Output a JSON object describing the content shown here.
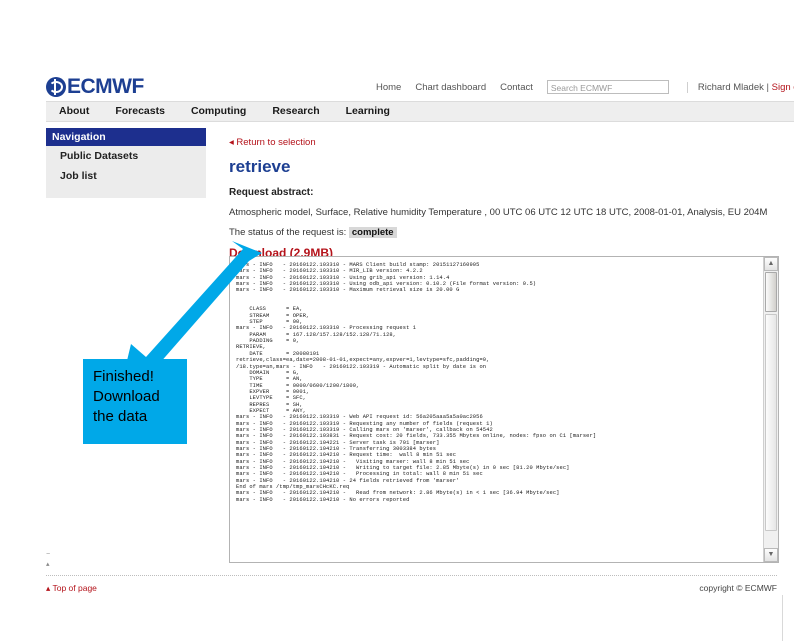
{
  "brand": {
    "wordmark": "ECMWF",
    "logo_icon": "ecmwf-globe-icon"
  },
  "utility_nav": {
    "items": [
      "Home",
      "Chart dashboard",
      "Contact"
    ],
    "search_placeholder": "Search ECMWF",
    "user_name": "Richard Mladek",
    "separator": "|",
    "sign_out": "Sign out"
  },
  "menubar": {
    "items": [
      "About",
      "Forecasts",
      "Computing",
      "Research",
      "Learning"
    ]
  },
  "sidebar": {
    "header": "Navigation",
    "items": [
      "Public Datasets",
      "Job list"
    ]
  },
  "content": {
    "back_link": "◂ Return to selection",
    "title": "retrieve",
    "abstract_label": "Request abstract:",
    "abstract": "Atmospheric model, Surface, Relative humidity Temperature , 00 UTC 06 UTC 12 UTC 18 UTC, 2008-01-01, Analysis, EU 204M",
    "status_prefix": "The status of the request is:",
    "status_value": "complete",
    "download_label": "Download (2.9MB)"
  },
  "console": {
    "log": "mars - INFO   - 20160122.103310 - MARS Client build stamp: 20151127160905\nmars - INFO   - 20160122.103310 - MIR_LIB version: 4.2.2\nmars - INFO   - 20160122.103310 - Using grib_api version: 1.14.4\nmars - INFO   - 20160122.103310 - Using odb_api version: 0.10.2 (File format version: 0.5)\nmars - INFO   - 20160122.103310 - Maximum retrieval size is 20.00 G\n\n\n    CLASS      = EA,\n    STREAM     = OPER,\n    STEP       = 00,\nmars - INFO   - 20160122.103310 - Processing request 1\n    PARAM      = 167.128/157.128/152.128/71.128,\n    PADDING    = 0,\nRETRIEVE,\n    DATE       = 20080101\nretrieve,class=ea,date=2008-01-01,expect=any,expver=1,levtype=sfc,padding=0,\n/18.type=an,mars - INFO   - 20160122.103319 - Automatic split by date is on\n    DOMAIN     = G,\n    TYPE       = AN,\n    TIME       = 0000/0600/1200/1800,\n    EXPVER     = 0001,\n    LEVTYPE    = SFC,\n    REPRES     = SH,\n    EXPECT     = ANY,\nmars - INFO   - 20160122.103319 - Web API request id: 56a205aaa5a5a0ac2056\nmars - INFO   - 20160122.103319 - Requesting any number of fields (request 1)\nmars - INFO   - 20160122.103319 - Calling mars on 'marser', callback on 54542\nmars - INFO   - 20160122.103831 - Request cost: 20 fields, 733.355 Mbytes online, nodes: fpso on C1 [marser]\nmars - INFO   - 20160122.104221 - Server task is 701 [marser]\nmars - INFO   - 20160122.104210 - Transferring 3003384 bytes\nmars - INFO   - 20160122.104210 - Request time:  wall 8 min 51 sec\nmars - INFO   - 20160122.104210 -   Visiting marser: wall 8 min 51 sec\nmars - INFO   - 20160122.104210 -   Writing to target file: 2.85 Mbyte(s) in 0 sec [81.20 Mbyte/sec]\nmars - INFO   - 20160122.104210 -   Processing in total: wall 8 min 51 sec\nmars - INFO   - 20160122.104210 - 24 fields retrieved from 'marser'\nEnd of mars /tmp/tmp_marsCHcKC.req\nmars - INFO   - 20160122.104210 -   Read from network: 2.86 Mbyte(s) in < 1 sec [36.94 Mbyte/sec]\nmars - INFO   - 20160122.104210 - No errors reported",
    "scroll_up_icon": "chevron-up-icon",
    "scroll_down_icon": "chevron-down-icon"
  },
  "annotation": {
    "callout_lines": [
      "Finished!",
      "Download",
      "the data"
    ],
    "callout_color": "#00a8e8",
    "arrow_icon": "arrow-up-right-icon"
  },
  "footer": {
    "top_of_page": "▴ Top of page",
    "copyright": "copyright © ECMWF"
  },
  "colors": {
    "brand_blue": "#1d3f92",
    "nav_header_blue": "#1d2f8e",
    "link_red": "#b4131b",
    "menubar_gray": "#eeeeee",
    "callout_cyan": "#00a8e8"
  }
}
